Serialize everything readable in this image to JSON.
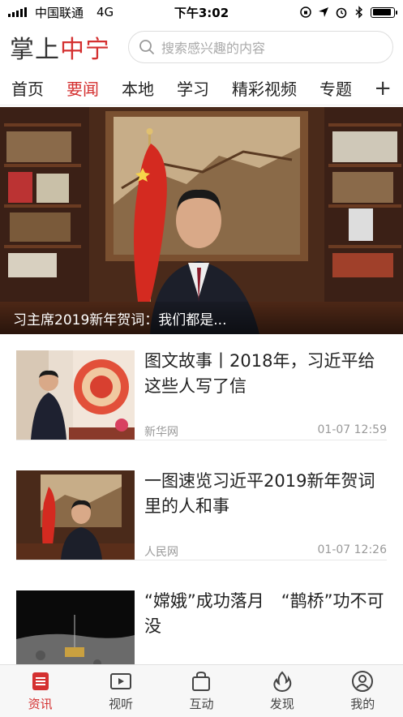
{
  "status_bar": {
    "carrier": "中国联通",
    "network": "4G",
    "time": "下午3:02"
  },
  "header": {
    "logo_part1": "掌上",
    "logo_part2": "中宁",
    "search_placeholder": "搜索感兴趣的内容"
  },
  "tabs": [
    {
      "label": "首页"
    },
    {
      "label": "要闻"
    },
    {
      "label": "本地"
    },
    {
      "label": "学习"
    },
    {
      "label": "精彩视频"
    },
    {
      "label": "专题"
    }
  ],
  "tab_add": "+",
  "hero": {
    "caption": "习主席2019新年贺词：我们都是..."
  },
  "news": [
    {
      "title": "图文故事丨2018年，习近平给这些人写了信",
      "source": "新华网",
      "time": "01-07 12:59"
    },
    {
      "title": "一图速览习近平2019新年贺词里的人和事",
      "source": "人民网",
      "time": "01-07 12:26"
    },
    {
      "title": "“嫦娥”成功落月　“鹊桥”功不可没",
      "source": "",
      "time": ""
    }
  ],
  "bottom_nav": [
    {
      "label": "资讯"
    },
    {
      "label": "视听"
    },
    {
      "label": "互动"
    },
    {
      "label": "发现"
    },
    {
      "label": "我的"
    }
  ],
  "colors": {
    "accent": "#d43030"
  }
}
